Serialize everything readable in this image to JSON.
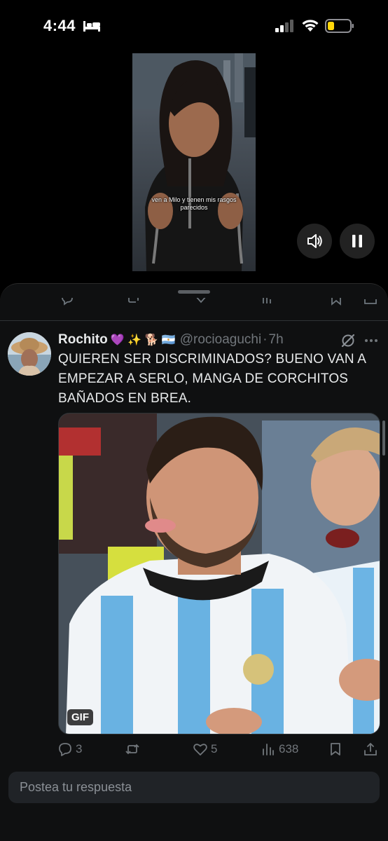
{
  "status_bar": {
    "time": "4:44",
    "battery_color": "#ffd60a"
  },
  "video": {
    "caption": "ven a Milo y tienen mis rasgos parecidos"
  },
  "tweet": {
    "display_name": "Rochito",
    "emojis": "💜 ✨ 🐕 🇦🇷",
    "handle": "@rocioaguchi",
    "separator": "·",
    "time": "7h",
    "text": "QUIEREN SER DISCRIMINADOS? BUENO VAN A EMPEZAR A SERLO,  MANGA DE CORCHITOS BAÑADOS EN BREA.",
    "media_badge": "GIF",
    "actions": {
      "replies": "3",
      "reposts": "",
      "likes": "5",
      "views": "638"
    }
  },
  "reply": {
    "placeholder": "Postea tu respuesta"
  },
  "colors": {
    "background": "#000000",
    "sheet": "#0f1011",
    "muted_text": "#71767b",
    "primary_text": "#e7e9ea"
  }
}
